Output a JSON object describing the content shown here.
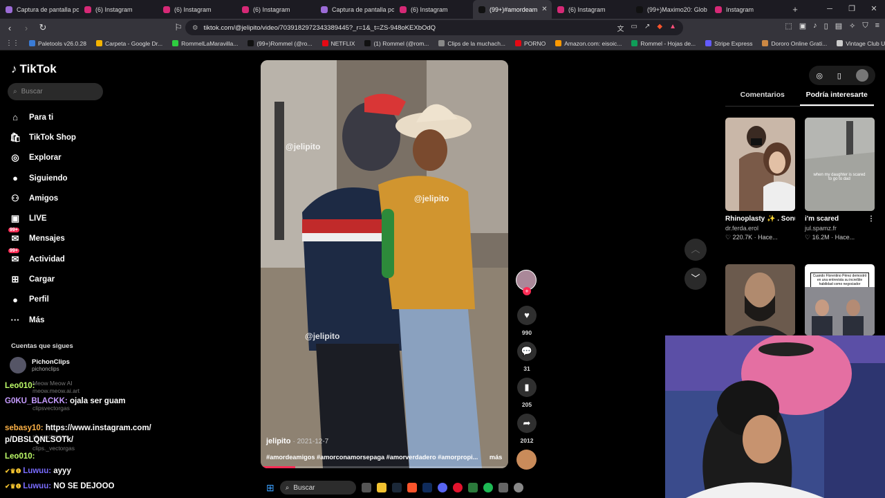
{
  "browser": {
    "tabs": [
      {
        "title": "Captura de pantalla po",
        "icon": "image-icon",
        "active": false
      },
      {
        "title": "(6) Instagram",
        "icon": "instagram-icon",
        "active": false
      },
      {
        "title": "(6) Instagram",
        "icon": "instagram-icon",
        "active": false
      },
      {
        "title": "(6) Instagram",
        "icon": "instagram-icon",
        "active": false
      },
      {
        "title": "Captura de pantalla po",
        "icon": "image-icon",
        "active": false
      },
      {
        "title": "(6) Instagram",
        "icon": "instagram-icon",
        "active": false
      },
      {
        "title": "(99+)#amordeam",
        "icon": "tiktok-icon",
        "active": true
      },
      {
        "title": "(6) Instagram",
        "icon": "instagram-icon",
        "active": false
      },
      {
        "title": "(99+)Maximo20: Glob",
        "icon": "tiktok-icon",
        "active": false
      },
      {
        "title": "Instagram",
        "icon": "instagram-icon",
        "active": false
      }
    ],
    "url": "tiktok.com/@jelipito/video/7039182972343389445?_r=1&_t=ZS-948oKEXbOdQ",
    "bookmarks": [
      "Paletools v26.0.28",
      "Carpeta - Google Dr...",
      "RommelLaMaravilla...",
      "(99+)Rommel (@ro...",
      "NETFLIX",
      "(1) Rommel (@rom...",
      "Clips de la muchach...",
      "PORNO",
      "Amazon.com: eisoic...",
      "Rommel - Hojas de...",
      "Stripe Express",
      "Dororo Online Grati...",
      "Vintage Club UK - O..."
    ]
  },
  "tiktok": {
    "logo": "TikTok",
    "search_placeholder": "Buscar",
    "nav": [
      {
        "label": "Para ti",
        "icon": "home-icon"
      },
      {
        "label": "TikTok Shop",
        "icon": "shop-icon"
      },
      {
        "label": "Explorar",
        "icon": "compass-icon"
      },
      {
        "label": "Siguiendo",
        "icon": "following-icon"
      },
      {
        "label": "Amigos",
        "icon": "friends-icon"
      },
      {
        "label": "LIVE",
        "icon": "live-icon"
      },
      {
        "label": "Mensajes",
        "icon": "messages-icon",
        "badge": "99+"
      },
      {
        "label": "Actividad",
        "icon": "activity-icon",
        "badge": "99+"
      },
      {
        "label": "Cargar",
        "icon": "upload-icon"
      },
      {
        "label": "Perfil",
        "icon": "profile-icon"
      },
      {
        "label": "Más",
        "icon": "more-icon"
      }
    ],
    "following_header": "Cuentas que sigues",
    "following": [
      {
        "name": "PichonClips",
        "handle": "pichonclips"
      },
      {
        "name": "Meow Meow AI",
        "handle": "meow.meow.ai.art"
      },
      {
        "name": "clipsvectorgas",
        "handle": "clipsvectorgas"
      },
      {
        "name": "chamituslunitos",
        "handle": "sb_vectorgas"
      },
      {
        "name": "clips._vectorgas",
        "handle": ""
      }
    ],
    "video": {
      "watermark": "@jelipito",
      "author": "jelipito",
      "date": "2021-12-7",
      "hashtags": "#amordeamigos #amorconamorsepaga #amorverdadero #amorpropi...",
      "more": "más",
      "progress_fraction": 0.14
    },
    "actions": {
      "likes": "990",
      "comments": "31",
      "saves": "205",
      "shares": "2012"
    },
    "panel_tabs": [
      "Comentarios",
      "Podría interesarte"
    ],
    "recommendations": [
      {
        "title": "Rhinoplasty ✨ . Sonuçlar kişiden...",
        "user": "dr.ferda.erol",
        "stats": "220.7K · Hace...",
        "thumb_color": "#c9b7a8"
      },
      {
        "title": "i'm scared",
        "user": "jul.spamz.fr",
        "stats": "16.2M · Hace...",
        "thumb_color": "#8f8f8a",
        "caption": "when my daughter is scared to go to dad"
      },
      {
        "title": "",
        "user": "",
        "stats": "",
        "thumb_color": "#6b5a4d"
      },
      {
        "title": "",
        "user": "",
        "stats": "",
        "thumb_color": "#8a8a90",
        "caption": "Cuando Florentino Pérez demostró en una entrevista su increíble habilidad como negociador"
      }
    ]
  },
  "chat": [
    {
      "user": "Leo010:",
      "msg": "",
      "color": "#c0ff6a"
    },
    {
      "user": "G0KU_BLACKK:",
      "msg": "ojala ser guam",
      "color": "#c69bff"
    },
    {
      "user": "sebasy10:",
      "msg": "https://www.instagram.com/",
      "color": "#ffb347"
    },
    {
      "user": "",
      "msg": "p/DBSLQNLSOTk/",
      "color": "#ffffff"
    },
    {
      "user": "Leo010:",
      "msg": "",
      "color": "#c0ff6a"
    },
    {
      "user": "Luwuu:",
      "msg": "ayyy",
      "color": "#7a6cff"
    },
    {
      "user": "Luwuu:",
      "msg": "NO SE DEJOOO",
      "color": "#7a6cff"
    }
  ],
  "taskbar": {
    "search_placeholder": "Buscar"
  }
}
